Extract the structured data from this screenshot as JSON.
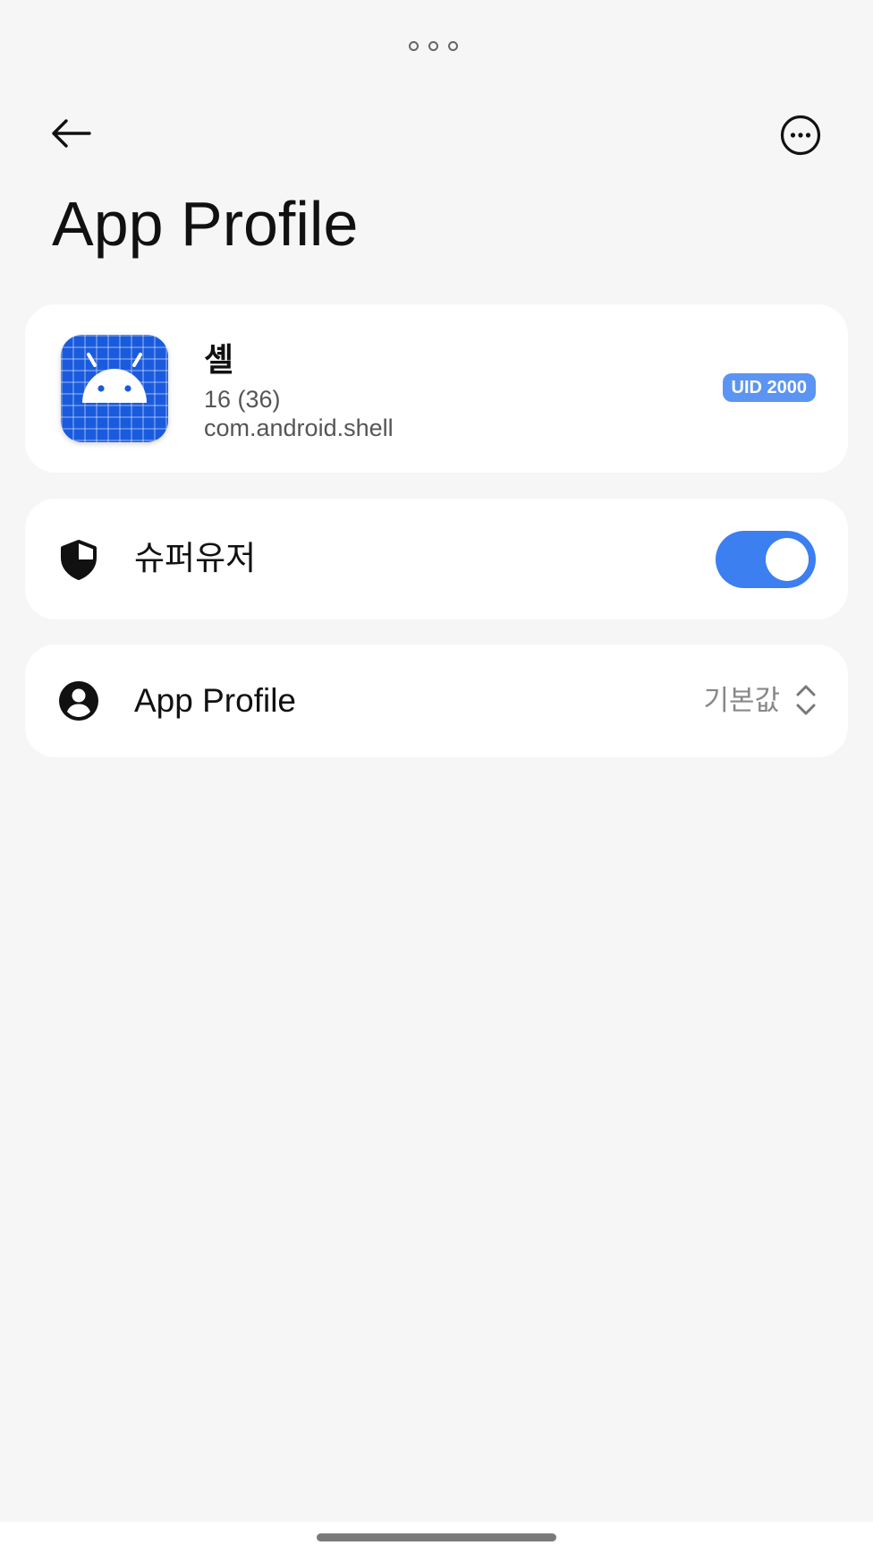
{
  "header": {
    "title": "App Profile",
    "back_icon": "arrow-left-icon",
    "more_icon": "more-horizontal-circle-icon"
  },
  "app_info": {
    "name": "셸",
    "version": "16 (36)",
    "package": "com.android.shell",
    "uid_badge": "UID 2000",
    "icon": "android-app-icon"
  },
  "superuser": {
    "label": "슈퍼유저",
    "icon": "shield-icon",
    "enabled": true
  },
  "profile": {
    "label": "App Profile",
    "value": "기본값",
    "icon": "account-circle-icon"
  },
  "colors": {
    "accent": "#3b7ff0",
    "badge": "#5b94f2",
    "background": "#f6f6f6",
    "card": "#ffffff"
  }
}
